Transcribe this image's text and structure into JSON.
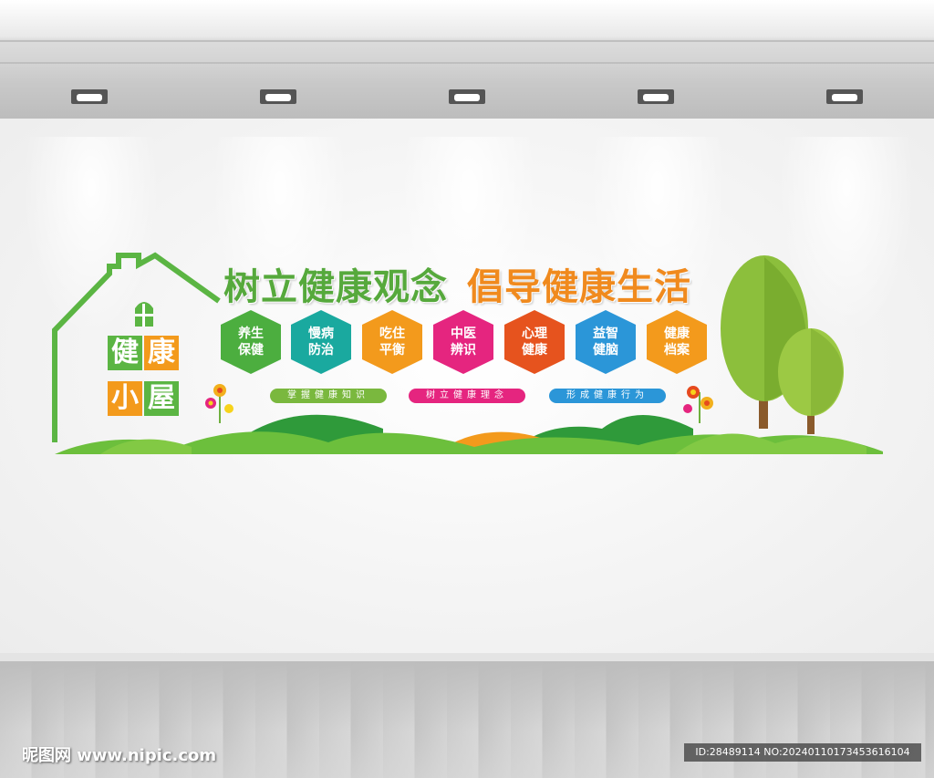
{
  "headline": {
    "part1": "树立健康观念",
    "part2": "倡导健康生活"
  },
  "sign": {
    "chars": [
      "健",
      "康",
      "小",
      "屋"
    ]
  },
  "hexagons": [
    {
      "label": "养生保健",
      "color": "#4cae3f"
    },
    {
      "label": "慢病防治",
      "color": "#1aa99f"
    },
    {
      "label": "吃住平衡",
      "color": "#f39a1c"
    },
    {
      "label": "中医辨识",
      "color": "#e5257f"
    },
    {
      "label": "心理健康",
      "color": "#e6531e"
    },
    {
      "label": "益智健脑",
      "color": "#2b96d8"
    },
    {
      "label": "健康档案",
      "color": "#f39a1c"
    }
  ],
  "slogans": [
    {
      "text": "掌握健康知识",
      "color": "#7ab83e"
    },
    {
      "text": "树立健康理念",
      "color": "#e5257f"
    },
    {
      "text": "形成健康行为",
      "color": "#2b96d8"
    }
  ],
  "watermark": {
    "site": "昵图网 www.nipic.com",
    "id": "ID:28489114 NO:20240110173453616104"
  }
}
